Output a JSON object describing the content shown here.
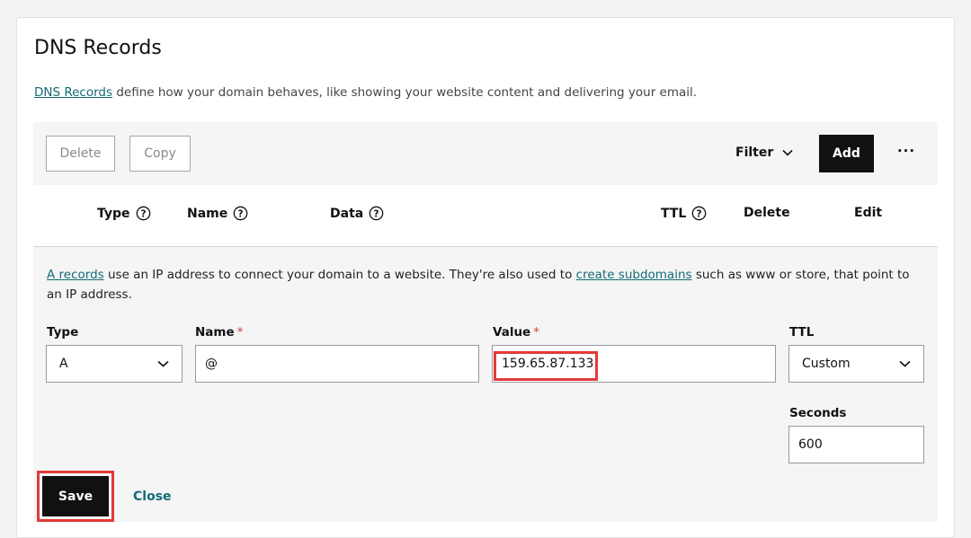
{
  "page": {
    "title": "DNS Records",
    "intro_link": "DNS Records",
    "intro_text": " define how your domain behaves, like showing your website content and delivering your email."
  },
  "toolbar": {
    "delete_label": "Delete",
    "copy_label": "Copy",
    "filter_label": "Filter",
    "add_label": "Add",
    "more_label": "···"
  },
  "table": {
    "headers": {
      "type": "Type",
      "name": "Name",
      "data": "Data",
      "ttl": "TTL",
      "delete": "Delete",
      "edit": "Edit"
    }
  },
  "edit_form": {
    "description": {
      "link1": "A records",
      "text1": " use an IP address to connect your domain to a website. They're also used to ",
      "link2": "create subdomains",
      "text2": " such as www or store, that point to an IP address."
    },
    "type": {
      "label": "Type",
      "value": "A"
    },
    "name": {
      "label": "Name",
      "required_mark": "*",
      "value": "@"
    },
    "value": {
      "label": "Value",
      "required_mark": "*",
      "value": "159.65.87.133"
    },
    "ttl": {
      "label": "TTL",
      "value": "Custom"
    },
    "seconds": {
      "label": "Seconds",
      "value": "600"
    },
    "save_label": "Save",
    "close_label": "Close"
  },
  "colors": {
    "accent_link": "#136b77",
    "primary_button": "#111111",
    "highlight": "#e23a3a",
    "required": "#d63c3c"
  },
  "icons": [
    "help-icon",
    "chevron-down-icon",
    "more-icon"
  ]
}
